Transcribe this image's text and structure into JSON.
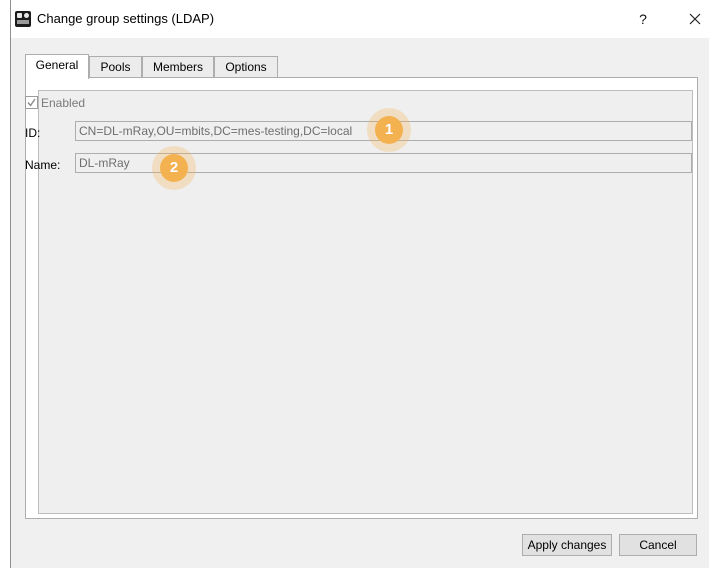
{
  "window": {
    "title": "Change group settings (LDAP)",
    "help_label": "?",
    "close_icon": "close-icon"
  },
  "tabs": [
    {
      "label": "General",
      "active": true
    },
    {
      "label": "Pools",
      "active": false
    },
    {
      "label": "Members",
      "active": false
    },
    {
      "label": "Options",
      "active": false
    }
  ],
  "general": {
    "enabled": {
      "label": "Enabled",
      "checked": true
    },
    "id": {
      "label": "ID:",
      "value": "CN=DL-mRay,OU=mbits,DC=mes-testing,DC=local"
    },
    "name": {
      "label": "Name:",
      "value": "DL-mRay"
    }
  },
  "annotations": [
    {
      "number": "1"
    },
    {
      "number": "2"
    }
  ],
  "footer": {
    "apply_label": "Apply changes",
    "cancel_label": "Cancel"
  },
  "colors": {
    "marker": "#f4b150",
    "window_bg": "#f0f0f0"
  }
}
